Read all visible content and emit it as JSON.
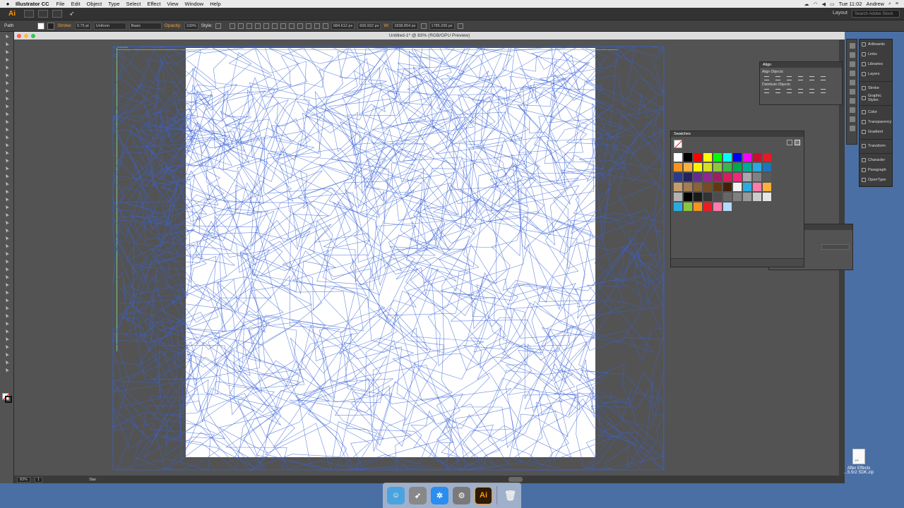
{
  "menubar": {
    "app_name": "Illustrator CC",
    "menus": [
      "File",
      "Edit",
      "Object",
      "Type",
      "Select",
      "Effect",
      "View",
      "Window",
      "Help"
    ],
    "clock": "Tue 11:02",
    "user": "Andrew"
  },
  "appbar": {
    "logo": "Ai",
    "workspace": "Layout",
    "search_placeholder": "Search Adobe Stock"
  },
  "controlbar": {
    "selection_type": "Path",
    "stroke_label": "Stroke:",
    "stroke_value": "0.75 pt",
    "profile": "Uniform",
    "brush": "Basic",
    "opacity_label": "Opacity:",
    "opacity_value": "100%",
    "style_label": "Style:",
    "x_value": "684.612 px",
    "y_value": "606.922 px",
    "w_label": "W:",
    "w_value": "1838.854 px",
    "h_value": "1785.265 px"
  },
  "document": {
    "title": "Untitled-1* @ 83% (RGB/GPU Preview)",
    "artboard_label": "Artboard",
    "zoom": "83%",
    "page": "1",
    "status": "Star"
  },
  "panels": {
    "align": {
      "title": "Align",
      "align_objects": "Align Objects:",
      "distribute_objects": "Distribute Objects:"
    },
    "swatches": {
      "title": "Swatches"
    },
    "dock": [
      {
        "label": "Artboards",
        "icon": "artboards-icon"
      },
      {
        "label": "Links",
        "icon": "links-icon"
      },
      {
        "label": "Libraries",
        "icon": "libraries-icon"
      },
      {
        "label": "Layers",
        "icon": "layers-icon"
      },
      {
        "label": "Stroke",
        "icon": "stroke-icon"
      },
      {
        "label": "Graphic Styles",
        "icon": "graphic-styles-icon"
      },
      {
        "label": "Color",
        "icon": "color-icon"
      },
      {
        "label": "Transparency",
        "icon": "transparency-icon"
      },
      {
        "label": "Gradient",
        "icon": "gradient-icon"
      },
      {
        "label": "Transform",
        "icon": "transform-icon"
      },
      {
        "label": "Character",
        "icon": "character-icon"
      },
      {
        "label": "Paragraph",
        "icon": "paragraph-icon"
      },
      {
        "label": "OpenType",
        "icon": "opentype-icon"
      }
    ]
  },
  "swatch_colors": [
    [
      "#ffffff",
      "#000000",
      "#ff0000",
      "#ffff00",
      "#00ff00",
      "#00ffff",
      "#0000ff",
      "#ff00ff",
      "#c8102e",
      "#e31b23"
    ],
    [
      "#f7941d",
      "#fbb040",
      "#fff200",
      "#d7df23",
      "#8dc63f",
      "#39b54a",
      "#00a651",
      "#00a99d",
      "#27aae1",
      "#1c75bc"
    ],
    [
      "#2b3990",
      "#262262",
      "#662d91",
      "#92278f",
      "#9e1f63",
      "#da1c5c",
      "#ee2a7b",
      "#a7a9ac",
      "#808285",
      "#58595b"
    ],
    [
      "#c69c6d",
      "#a67c52",
      "#8c6239",
      "#754c24",
      "#603913",
      "#42210b",
      "#f2f2f2",
      "#29abe2",
      "#ff7bac",
      "#fbb03b"
    ],
    [
      "#b3b3b3",
      "#000000",
      "#1a1a1a",
      "#333333",
      "#4d4d4d",
      "#666666",
      "#808080",
      "#999999",
      "#cccccc",
      "#e6e6e6"
    ],
    [
      "#29abe2",
      "#8cc63f",
      "#f7931e",
      "#ed1c24",
      "#ff7bac",
      "#b3d9ff"
    ]
  ],
  "desktop": {
    "file_name_1": "After Effects",
    "file_name_2": "...5.5r2 SDK.zip"
  },
  "colors": {
    "path_blue": "#3b63d6",
    "guide_green": "#7fc77f",
    "ui_dark": "#323232",
    "ui_mid": "#535353",
    "desktop": "#4a6fa5",
    "accent_orange": "#ff9a00"
  }
}
